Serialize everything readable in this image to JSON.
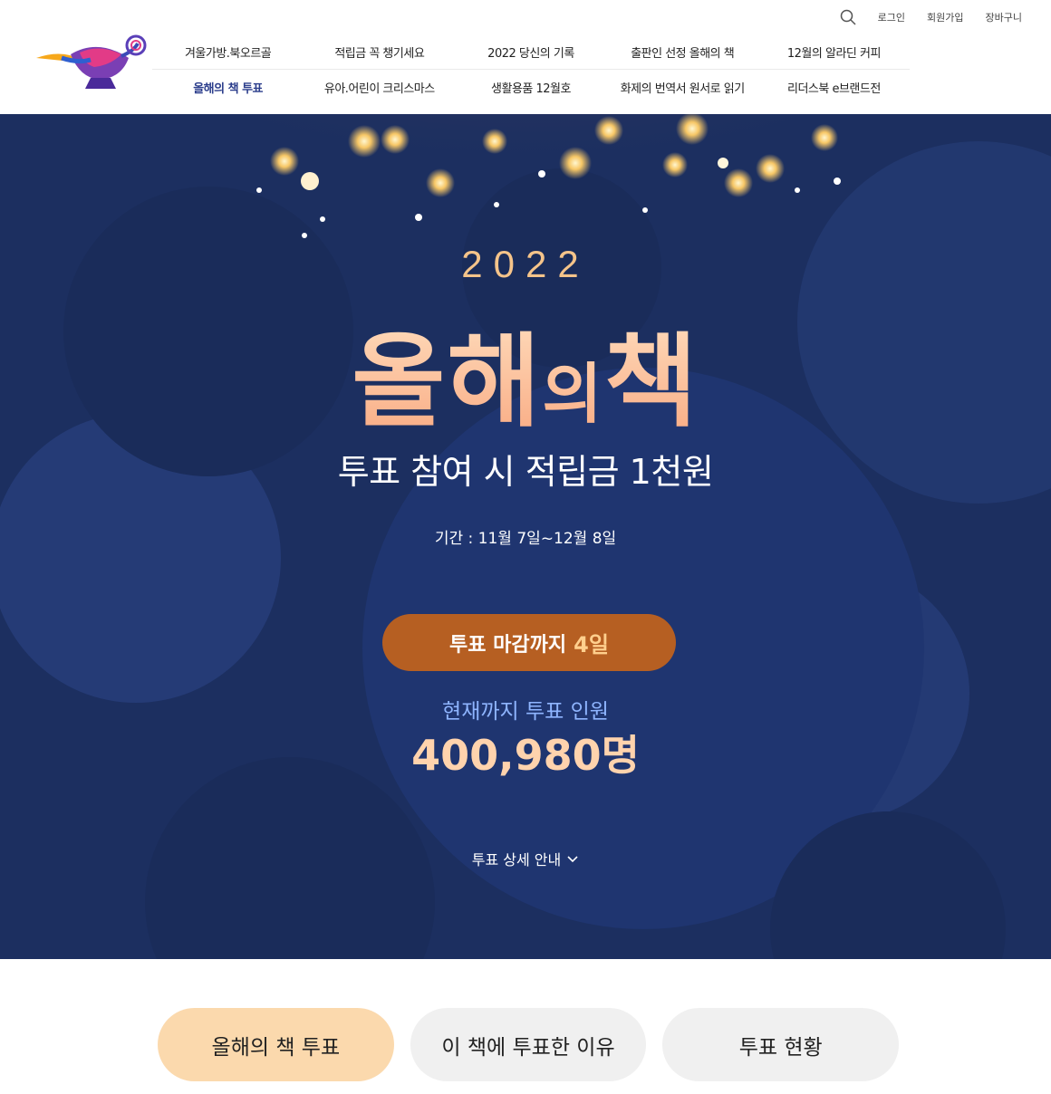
{
  "header": {
    "logo_name": "aladin-lamp-logo",
    "util": {
      "search_icon": "search-icon",
      "login": "로그인",
      "signup": "회원가입",
      "cart": "장바구니"
    },
    "nav_row1": [
      "겨울가방.북오르골",
      "적립금 꼭 챙기세요",
      "2022 당신의 기록",
      "출판인 선정 올해의 책",
      "12월의 알라딘 커피"
    ],
    "nav_row2": [
      "올해의 책 투표",
      "유아.어린이 크리스마스",
      "생활용품 12월호",
      "화제의 번역서 원서로 읽기",
      "리더스북 e브랜드전"
    ],
    "active_nav": "올해의 책 투표"
  },
  "hero": {
    "year": "2022",
    "title": {
      "part1": "올해",
      "part2": "의",
      "part3": "책"
    },
    "subtitle": "투표 참여 시 적립금 1천원",
    "period": "기간 : 11월 7일~12월 8일",
    "deadline_prefix": "투표 마감까지",
    "deadline_days": "4일",
    "count_label": "현재까지 투표 인원",
    "count_value": "400,980명",
    "detail_link": "투표 상세 안내",
    "colors": {
      "background": "#1e3163",
      "accent": "#b65f22",
      "title": "#fdc99a"
    }
  },
  "tabs": [
    {
      "label": "올해의 책 투표",
      "active": true
    },
    {
      "label": "이 책에 투표한 이유",
      "active": false
    },
    {
      "label": "투표 현황",
      "active": false
    }
  ]
}
